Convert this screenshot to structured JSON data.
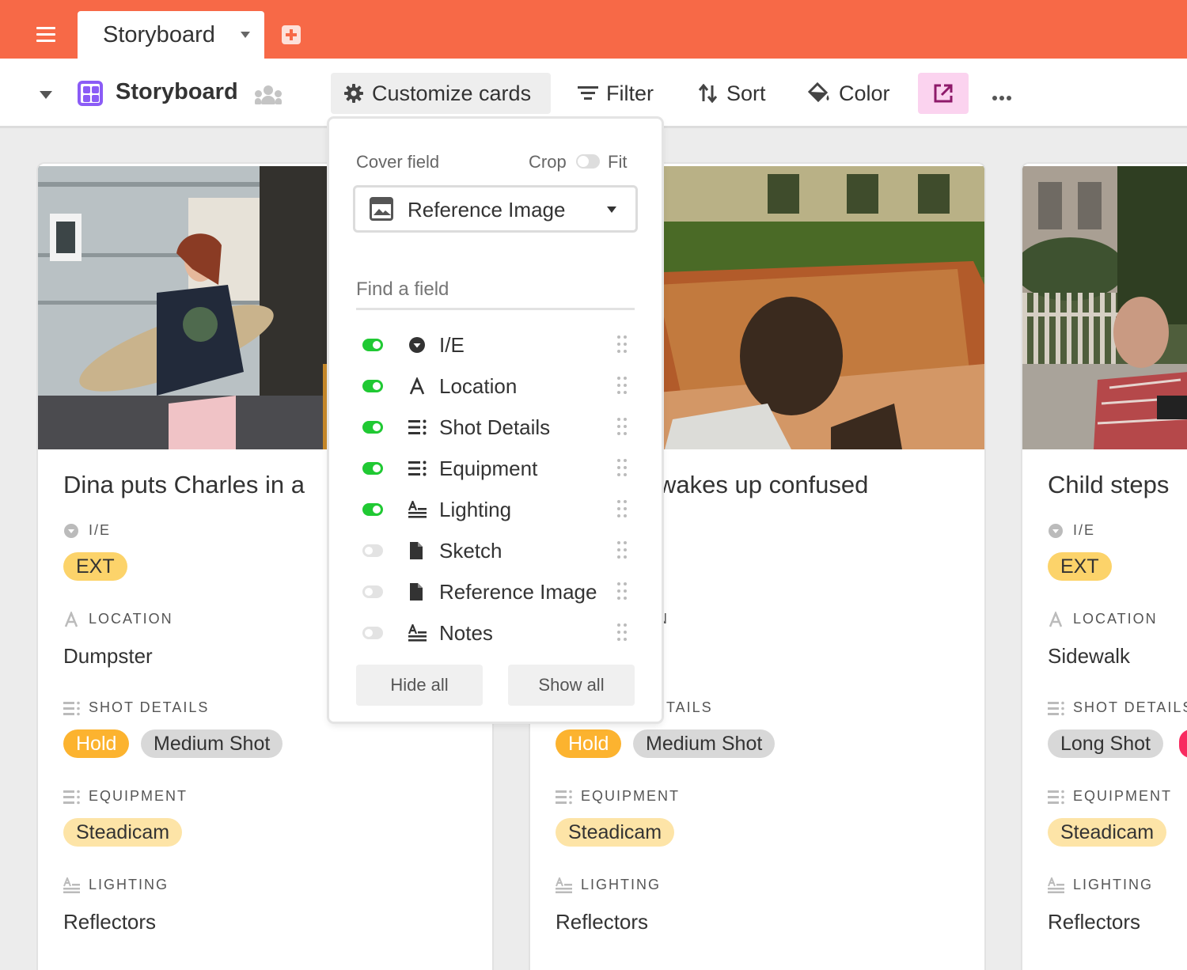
{
  "topbar": {
    "tab_label": "Storyboard"
  },
  "toolbar": {
    "view_name": "Storyboard",
    "customize_label": "Customize cards",
    "filter_label": "Filter",
    "sort_label": "Sort",
    "color_label": "Color"
  },
  "popup": {
    "cover_field_label": "Cover field",
    "crop_label": "Crop",
    "fit_label": "Fit",
    "cover_field_value": "Reference Image",
    "find_placeholder": "Find a field",
    "fields": [
      {
        "label": "I/E",
        "visible": true,
        "icon": "single-select-icon"
      },
      {
        "label": "Location",
        "visible": true,
        "icon": "text-icon"
      },
      {
        "label": "Shot Details",
        "visible": true,
        "icon": "multi-select-icon"
      },
      {
        "label": "Equipment",
        "visible": true,
        "icon": "multi-select-icon"
      },
      {
        "label": "Lighting",
        "visible": true,
        "icon": "long-text-icon"
      },
      {
        "label": "Sketch",
        "visible": false,
        "icon": "attachment-icon"
      },
      {
        "label": "Reference Image",
        "visible": false,
        "icon": "attachment-icon"
      },
      {
        "label": "Notes",
        "visible": false,
        "icon": "long-text-icon"
      }
    ],
    "hide_all_label": "Hide all",
    "show_all_label": "Show all"
  },
  "cards": [
    {
      "title": "Dina puts Charles in a",
      "ie_label": "I/E",
      "ie_value": "EXT",
      "location_label": "LOCATION",
      "location_value": "Dumpster",
      "shot_label": "SHOT DETAILS",
      "shot_values": [
        "Hold",
        "Medium Shot"
      ],
      "equipment_label": "EQUIPMENT",
      "equipment_value": "Steadicam",
      "lighting_label": "LIGHTING",
      "lighting_value": "Reflectors"
    },
    {
      "title": "wakes up confused",
      "location_label_partial": "N",
      "shot_label_partial": "TAILS",
      "shot_values": [
        "Hold",
        "Medium Shot"
      ],
      "equipment_label": "EQUIPMENT",
      "equipment_value": "Steadicam",
      "lighting_label": "LIGHTING",
      "lighting_value": "Reflectors"
    },
    {
      "title": "Child steps",
      "ie_label": "I/E",
      "ie_value": "EXT",
      "location_label": "LOCATION",
      "location_value": "Sidewalk",
      "shot_label": "SHOT DETAILS",
      "shot_values": [
        "Long Shot"
      ],
      "equipment_label": "EQUIPMENT",
      "equipment_value": "Steadicam",
      "lighting_label": "LIGHTING",
      "lighting_value": "Reflectors"
    }
  ],
  "colors": {
    "topbar": "#f76947",
    "view_icon": "#8b5cf6",
    "toggle_on": "#20c933",
    "hold_pill": "#fcb32f",
    "ext_pill": "#fcd36a",
    "share_button": "#fbd3ef"
  }
}
